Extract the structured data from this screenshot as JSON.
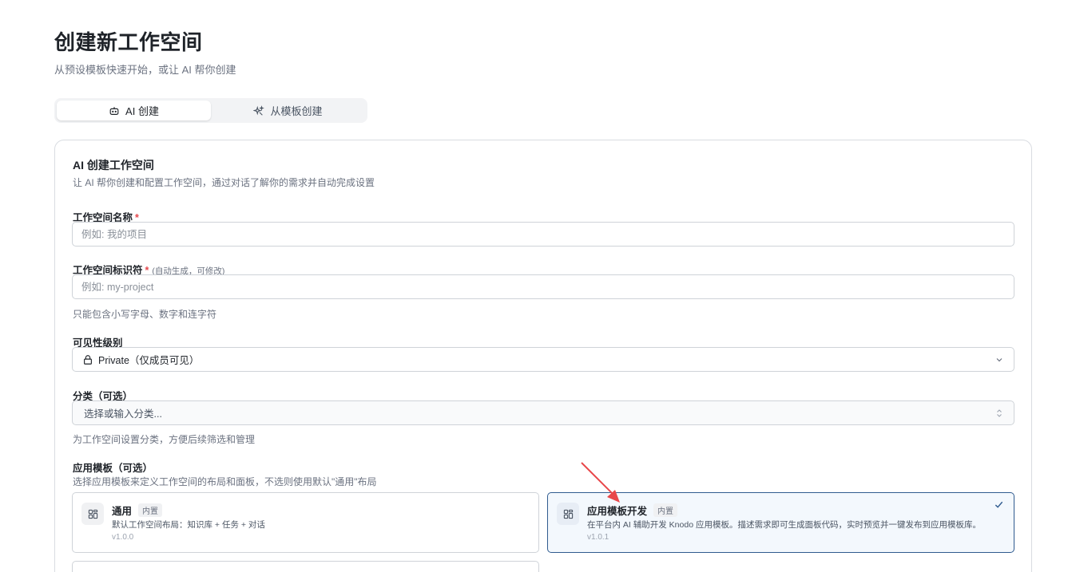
{
  "header": {
    "title": "创建新工作空间",
    "subtitle": "从预设模板快速开始，或让 AI 帮你创建"
  },
  "mode_tabs": [
    {
      "label": "AI 创建",
      "icon": "bot-icon",
      "active": true
    },
    {
      "label": "从模板创建",
      "icon": "sparkles-icon",
      "active": false
    }
  ],
  "form": {
    "title": "AI 创建工作空间",
    "description": "让 AI 帮你创建和配置工作空间，通过对话了解你的需求并自动完成设置",
    "name_field": {
      "label": "工作空间名称",
      "required_mark": "*",
      "placeholder": "例如: 我的项目",
      "value": ""
    },
    "slug_field": {
      "label": "工作空间标识符",
      "required_mark": "*",
      "note": "(自动生成，可修改)",
      "placeholder": "例如: my-project",
      "value": "",
      "hint": "只能包含小写字母、数字和连字符"
    },
    "visibility_field": {
      "label": "可见性级别",
      "value": "Private（仅成员可见）",
      "icon": "lock-icon"
    },
    "category_field": {
      "label": "分类（可选）",
      "placeholder": "选择或输入分类...",
      "hint": "为工作空间设置分类，方便后续筛选和管理"
    },
    "template_field": {
      "label": "应用模板（可选）",
      "description": "选择应用模板来定义工作空间的布局和面板，不选则使用默认\"通用\"布局",
      "templates": [
        {
          "name": "通用",
          "badge": "内置",
          "description": "默认工作空间布局：知识库 + 任务 + 对话",
          "version": "v1.0.0",
          "selected": false
        },
        {
          "name": "应用模板开发",
          "badge": "内置",
          "description": "在平台内 AI 辅助开发 Knodo 应用模板。描述需求即可生成面板代码，实时预览并一键发布到应用模板库。",
          "version": "v1.0.1",
          "selected": true
        }
      ]
    }
  },
  "colors": {
    "accent": "#2f5b8f",
    "required": "#e5484d",
    "annotation_arrow": "#e8474a"
  }
}
